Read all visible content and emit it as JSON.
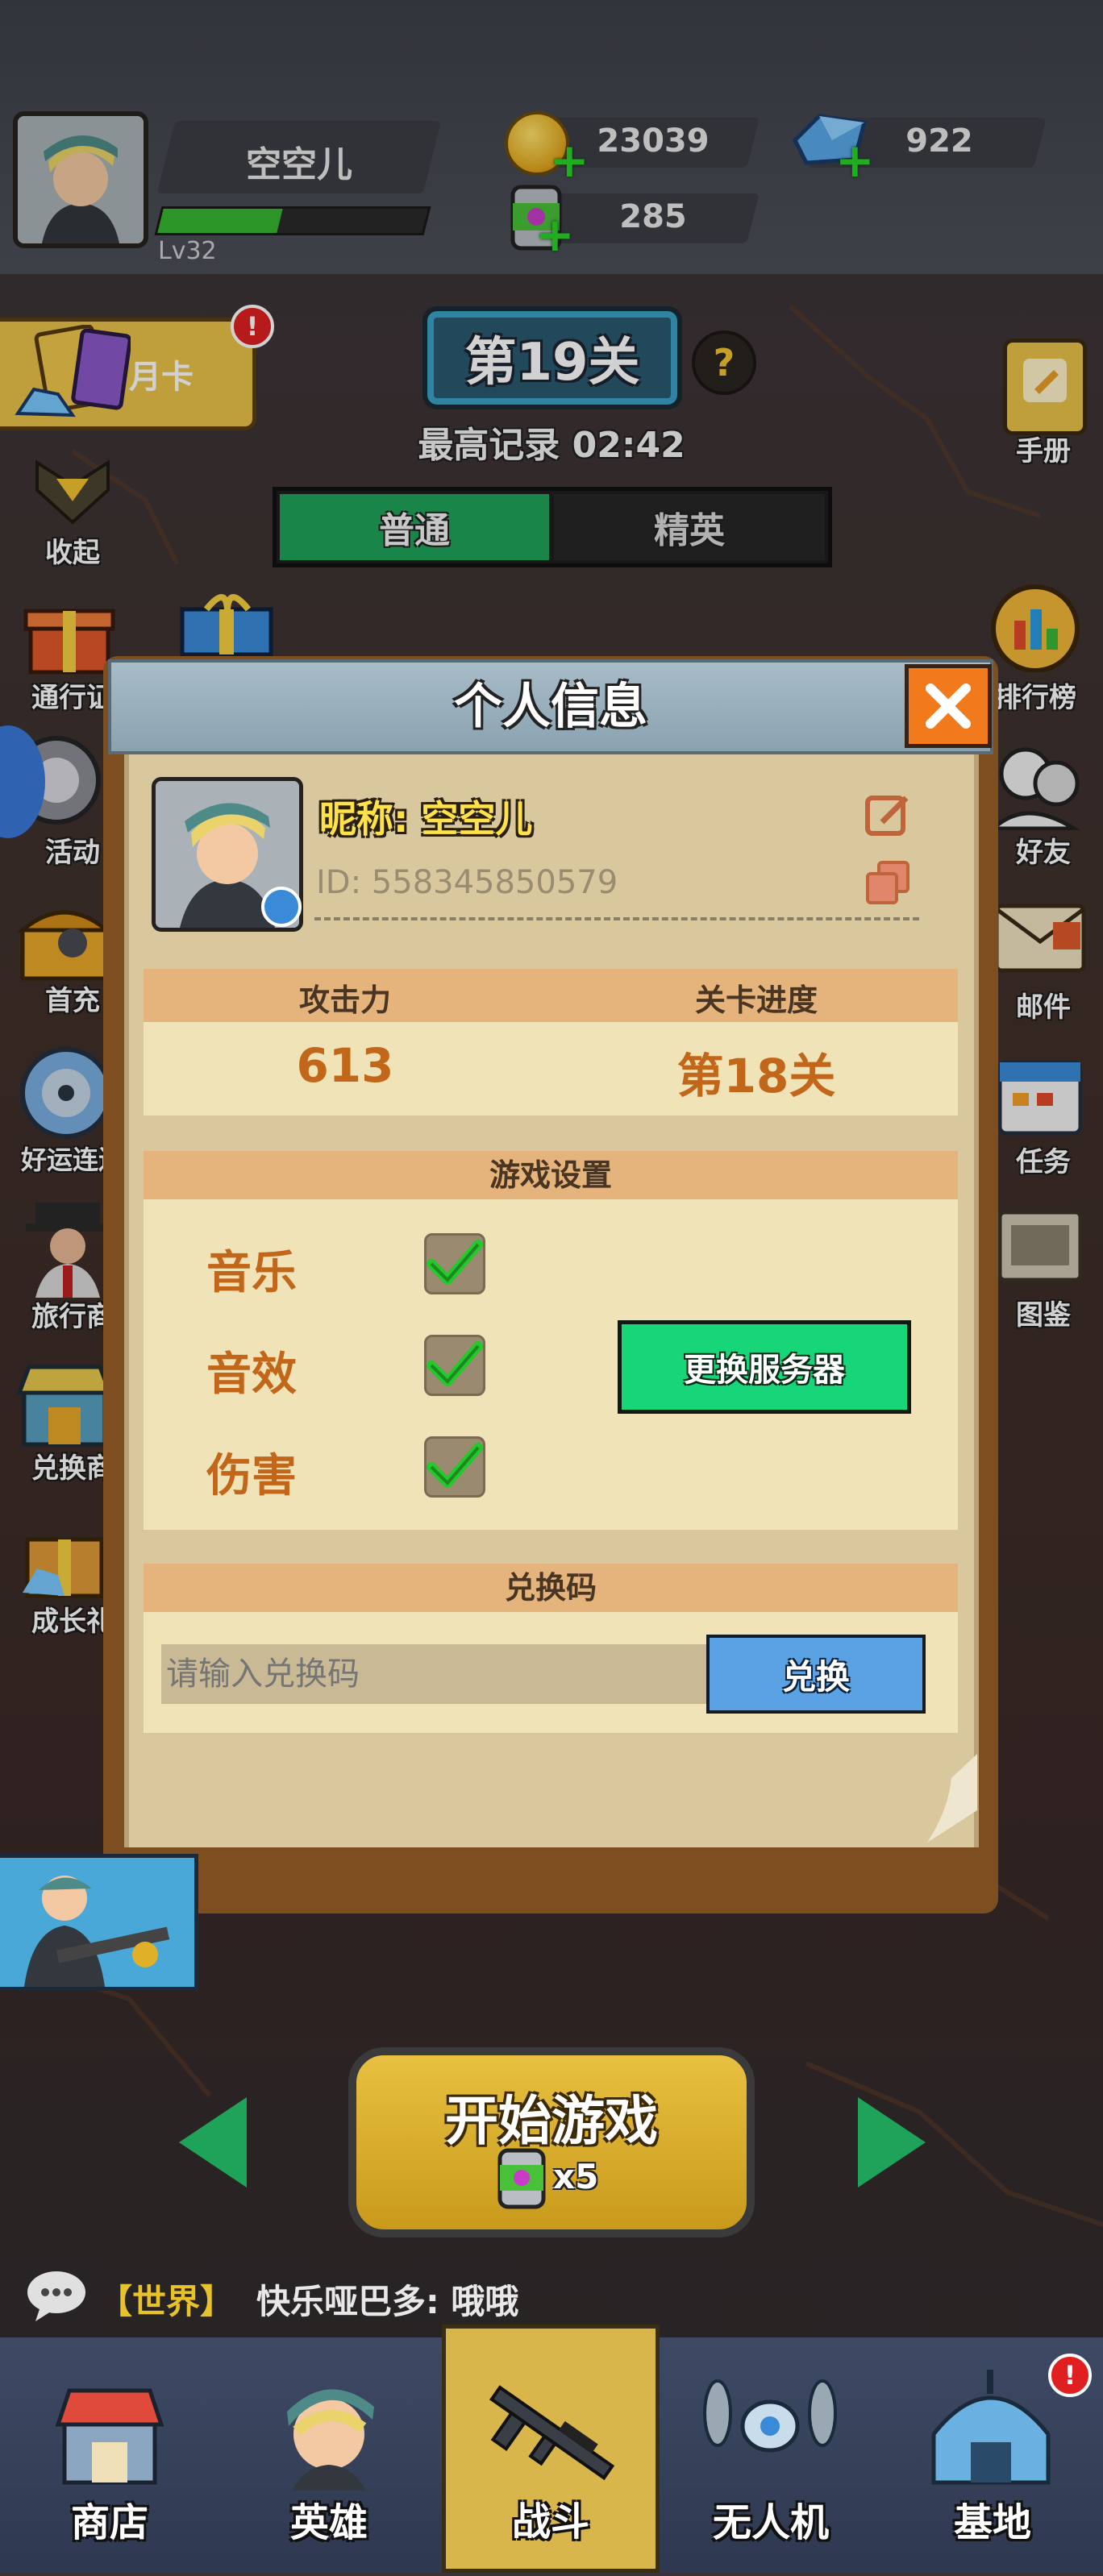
{
  "player": {
    "name": "空空儿",
    "level": "Lv32",
    "xp_fraction": 0.45
  },
  "currency": {
    "coins": "23039",
    "gems": "922",
    "energy": "285"
  },
  "side_left": [
    {
      "label": "月卡",
      "icon": "card-icon"
    },
    {
      "label": "收起",
      "icon": "collapse-icon"
    },
    {
      "label": "通行证",
      "icon": "gift-icon"
    },
    {
      "label": "活动",
      "icon": "event-icon"
    },
    {
      "label": "首充",
      "icon": "chest-icon"
    },
    {
      "label": "好运连连",
      "icon": "wheel-icon"
    },
    {
      "label": "旅行商",
      "icon": "merchant-icon"
    },
    {
      "label": "兑换商",
      "icon": "shop-icon"
    },
    {
      "label": "成长礼",
      "icon": "growth-gift-icon"
    }
  ],
  "side_right": [
    {
      "label": "手册",
      "icon": "manual-icon"
    },
    {
      "label": "排行榜",
      "icon": "ranking-icon"
    },
    {
      "label": "好友",
      "icon": "friends-icon"
    },
    {
      "label": "邮件",
      "icon": "mail-icon"
    },
    {
      "label": "任务",
      "icon": "task-icon"
    },
    {
      "label": "图鉴",
      "icon": "codex-icon"
    }
  ],
  "stage": {
    "title": "第19关",
    "help": "?",
    "best_record": "最高记录 02:42",
    "tabs": [
      {
        "label": "普通"
      },
      {
        "label": "精英"
      }
    ]
  },
  "modal": {
    "title": "个人信息",
    "nickname": "昵称: 空空儿",
    "id": "ID: 558345850579",
    "stats": {
      "attack_label": "攻击力",
      "attack_value": "613",
      "progress_label": "关卡进度",
      "progress_value": "第18关"
    },
    "settings": {
      "header": "游戏设置",
      "items": [
        {
          "label": "音乐",
          "checked": true
        },
        {
          "label": "音效",
          "checked": true
        },
        {
          "label": "伤害",
          "checked": true
        }
      ],
      "change_server": "更换服务器"
    },
    "redeem": {
      "header": "兑换码",
      "placeholder": "请输入兑换码",
      "button": "兑换"
    }
  },
  "start": {
    "label": "开始游戏",
    "cost": "x5"
  },
  "chat": {
    "channel": "【世界】",
    "message": "快乐哑巴多: 哦哦"
  },
  "nav": [
    {
      "label": "商店",
      "icon": "store-icon"
    },
    {
      "label": "英雄",
      "icon": "hero-icon"
    },
    {
      "label": "战斗",
      "icon": "rifle-icon"
    },
    {
      "label": "无人机",
      "icon": "drone-icon"
    },
    {
      "label": "基地",
      "icon": "base-icon"
    }
  ],
  "badge": "!",
  "colors": {
    "accent_green": "#17d679",
    "accent_blue": "#5aa2e4",
    "close_orange": "#f07a1c",
    "text_orange": "#c2661a",
    "tab_active": "#1fa35a",
    "chat_channel": "#e7c22a"
  }
}
